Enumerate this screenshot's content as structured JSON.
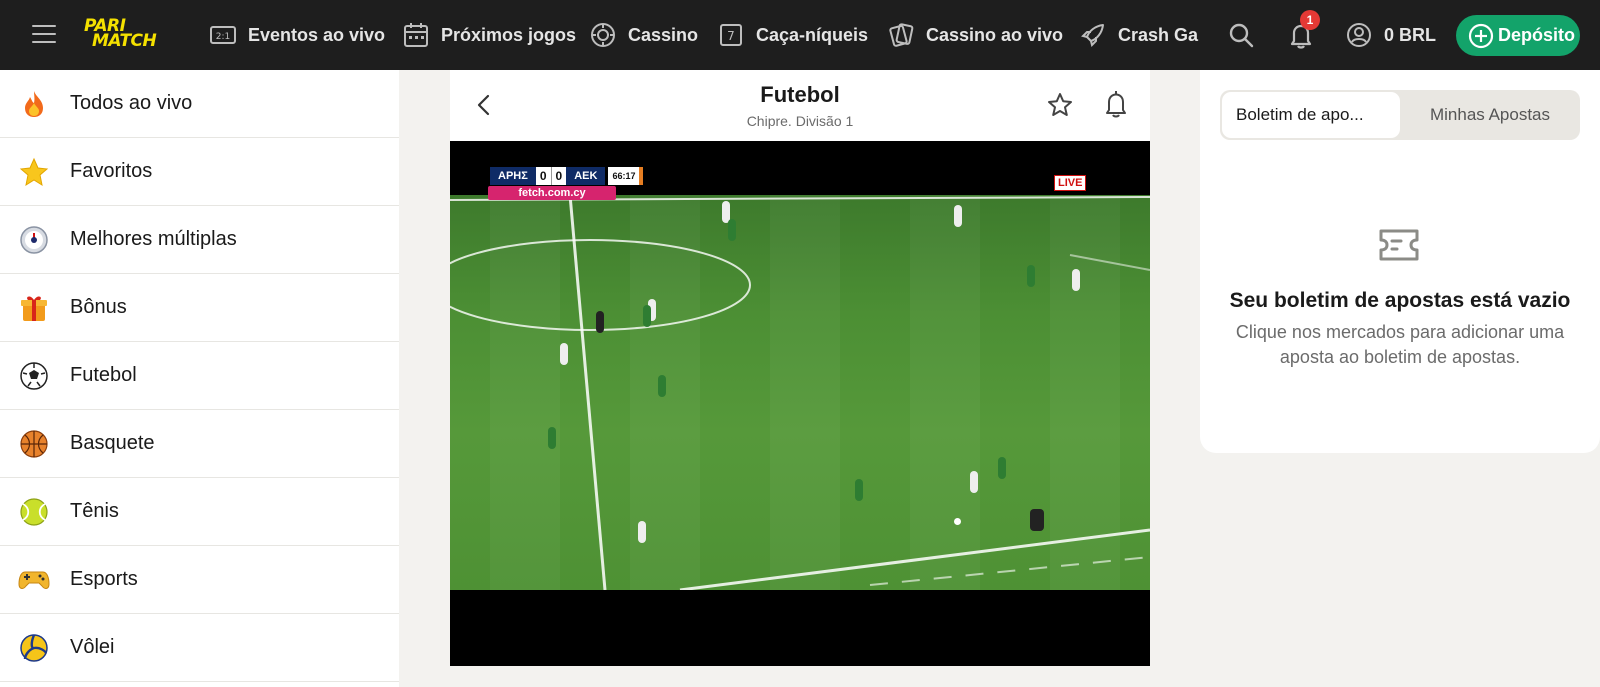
{
  "header": {
    "logo_line1": "PARI",
    "logo_line2": "MATCH",
    "nav": [
      {
        "label": "Eventos ao vivo",
        "icon": "live-scoreboard-icon"
      },
      {
        "label": "Próximos jogos",
        "icon": "calendar-icon"
      },
      {
        "label": "Cassino",
        "icon": "casino-chip-icon"
      },
      {
        "label": "Caça-níqueis",
        "icon": "slot-machine-icon"
      },
      {
        "label": "Cassino ao vivo",
        "icon": "cards-icon"
      },
      {
        "label": "Crash Ga",
        "icon": "rocket-icon"
      }
    ],
    "notification_count": "1",
    "balance": "0 BRL",
    "deposit_label": "Depósito",
    "accent_color": "#13a36a",
    "logo_color": "#f5e100"
  },
  "sidebar": {
    "items": [
      {
        "label": "Todos ao vivo",
        "icon": "fire-icon"
      },
      {
        "label": "Favoritos",
        "icon": "star-icon"
      },
      {
        "label": "Melhores múltiplas",
        "icon": "gauge-icon"
      },
      {
        "label": "Bônus",
        "icon": "gift-icon"
      },
      {
        "label": "Futebol",
        "icon": "soccer-ball-icon"
      },
      {
        "label": "Basquete",
        "icon": "basketball-icon"
      },
      {
        "label": "Tênis",
        "icon": "tennis-ball-icon"
      },
      {
        "label": "Esports",
        "icon": "gamepad-icon"
      },
      {
        "label": "Vôlei",
        "icon": "volleyball-icon"
      }
    ]
  },
  "match": {
    "title": "Futebol",
    "subtitle": "Chipre. Divisão 1"
  },
  "video": {
    "home": "ΑΡΗΣ",
    "home_score": "0",
    "away_score": "0",
    "away": "ΑΕΚ",
    "clock": "66:17",
    "site": "fetch.com.cy",
    "live_label": "LIVE"
  },
  "betslip": {
    "tab_active": "Boletim de apo...",
    "tab_other": "Minhas Apostas",
    "empty_title": "Seu boletim de apostas está vazio",
    "empty_desc": "Clique nos mercados para adicionar uma aposta ao boletim de apostas."
  }
}
